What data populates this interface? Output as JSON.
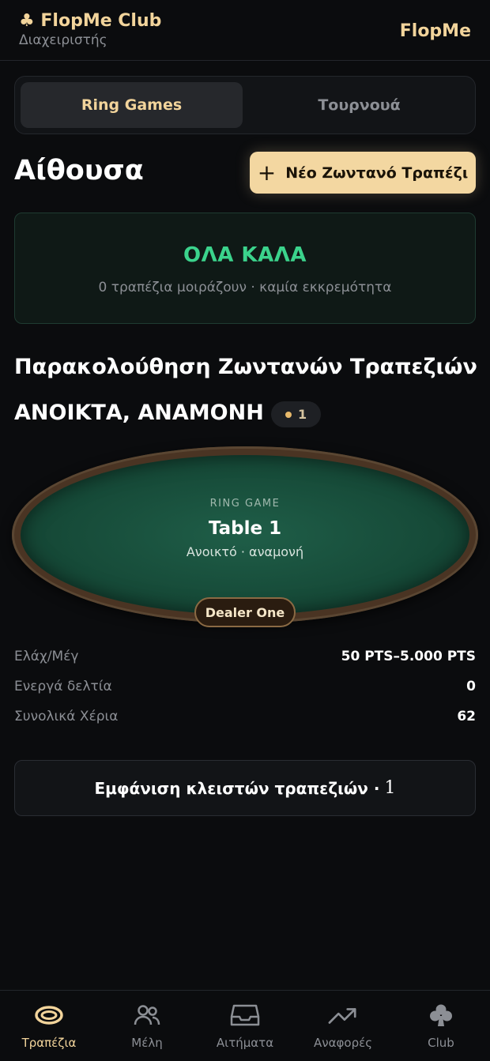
{
  "header": {
    "club_name": "♣ FlopMe Club",
    "role": "Διαχειριστής",
    "brand": "FlopMe"
  },
  "segment": {
    "active": "Ring Games",
    "inactive": "Τουρνουά"
  },
  "lobby": {
    "title": "Αίθουσα",
    "new_table_label": "Νέο Ζωντανό Τραπέζι"
  },
  "status": {
    "main": "ΟΛΑ ΚΑΛΑ",
    "sub": "0 τραπέζια μοιράζουν · καμία εκκρεμότητα"
  },
  "monitor": {
    "title": "Παρακολούθηση Ζωντανών Τραπεζιών",
    "section": "ΑΝΟΙΚΤΑ, ΑΝΑΜΟΝΗ",
    "count": "1"
  },
  "table": {
    "type": "RING GAME",
    "name": "Table 1",
    "status": "Ανοικτό · αναμονή",
    "dealer": "Dealer One"
  },
  "stats": [
    {
      "label": "Ελάχ/Μέγ",
      "value": "50 PTS–5.000 PTS"
    },
    {
      "label": "Ενεργά δελτία",
      "value": "0"
    },
    {
      "label": "Συνολικά Χέρια",
      "value": "62"
    }
  ],
  "closed": {
    "label": "Εμφάνιση κλειστών τραπεζιών ·",
    "count": "1"
  },
  "nav": [
    {
      "label": "Τραπέζια",
      "icon": "table-icon",
      "active": true
    },
    {
      "label": "Μέλη",
      "icon": "members-icon"
    },
    {
      "label": "Αιτήματα",
      "icon": "inbox-icon"
    },
    {
      "label": "Αναφορές",
      "icon": "trend-icon"
    },
    {
      "label": "Club",
      "icon": "club-icon"
    }
  ],
  "colors": {
    "accent": "#f2d49b",
    "ok": "#3bd38c",
    "felt": "#1a5440",
    "background": "#0b0c0e"
  }
}
